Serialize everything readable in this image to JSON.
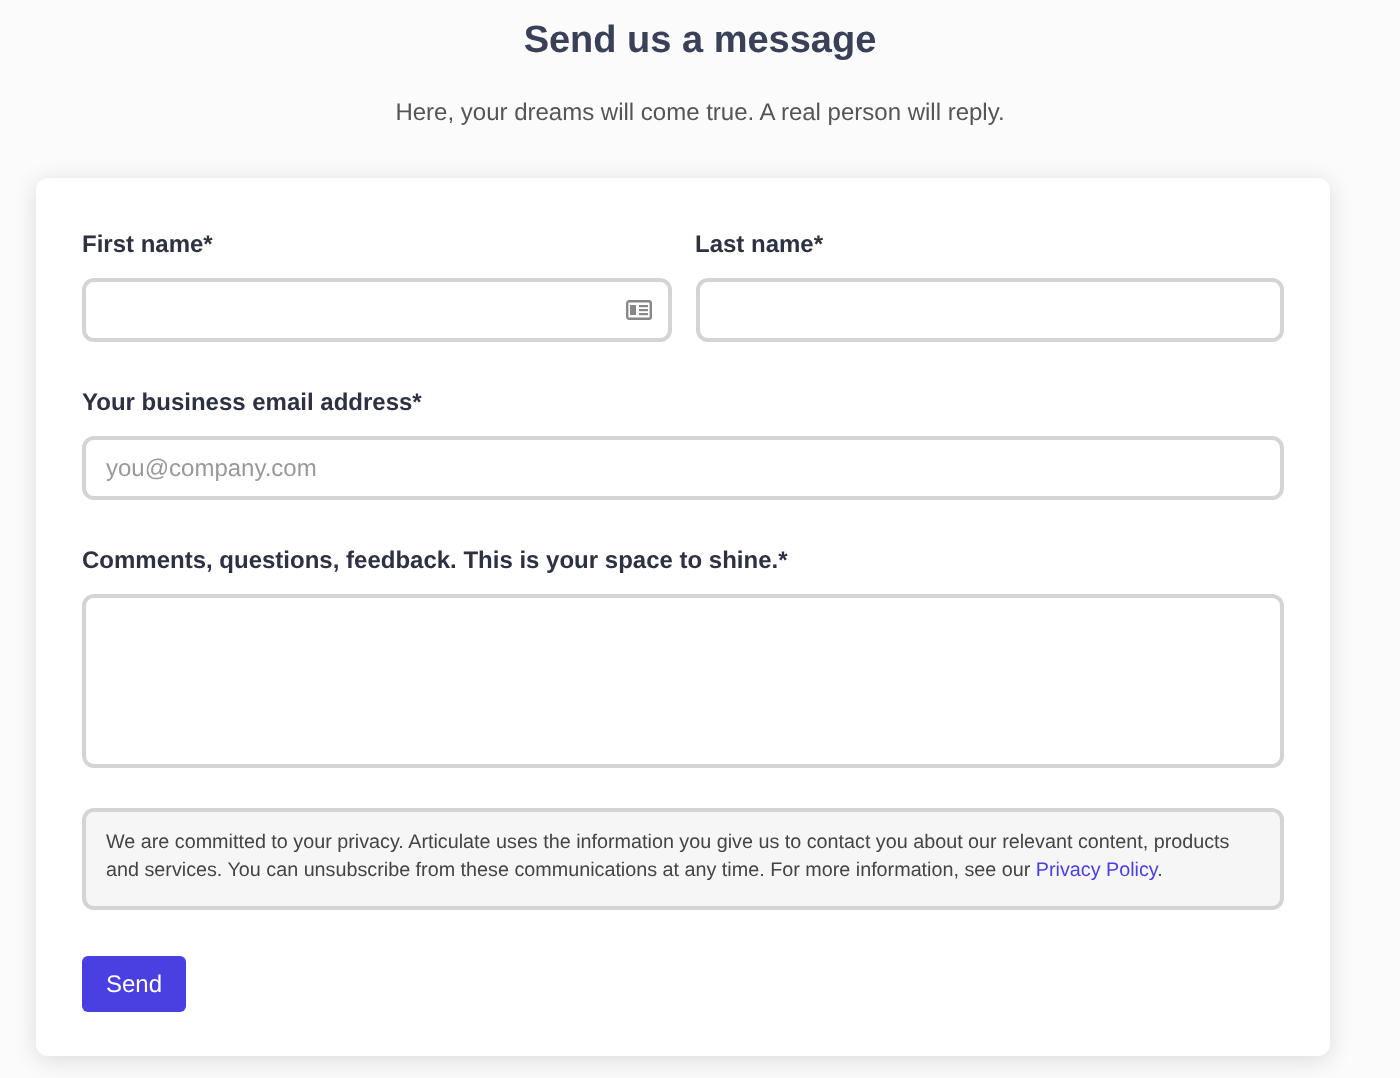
{
  "title": "Send us a message",
  "subtitle": "Here, your dreams will come true. A real person will reply.",
  "form": {
    "rows": [
      {
        "fields": [
          {
            "label": "First name*",
            "kind": "card_input"
          },
          {
            "label": "Last name*",
            "kind": "input"
          }
        ]
      },
      {
        "fields": [
          {
            "label": "Your business email address*",
            "kind": "input",
            "placeholder": "you@company.com"
          }
        ]
      },
      {
        "fields": [
          {
            "label": "Comments, questions, feedback. This is your space to shine.*",
            "kind": "textarea"
          }
        ]
      }
    ],
    "privacy": {
      "text": "We are committed to your privacy. Articulate uses the information you give us to contact you about our relevant content, products and services. You can unsubscribe from these communications at any time. For more information, see our ",
      "link": "Privacy Policy",
      "after": "."
    },
    "submit": "Send"
  }
}
